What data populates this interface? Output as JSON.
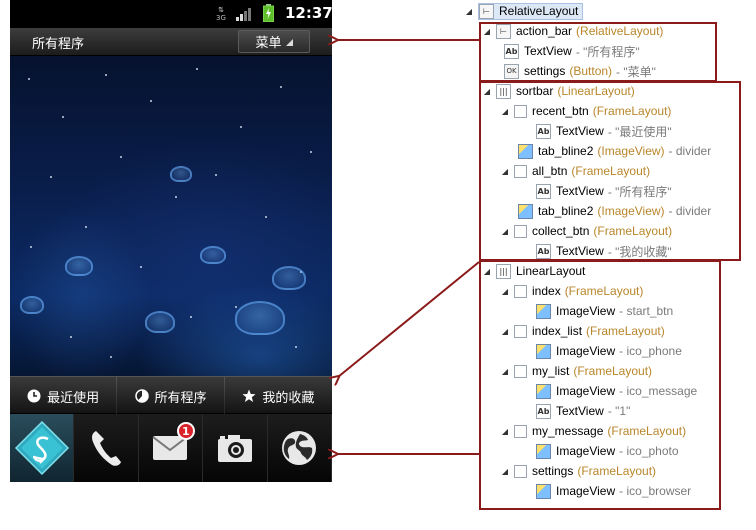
{
  "phone": {
    "statusbar": {
      "network_label": "3G",
      "time": "12:37"
    },
    "action_bar": {
      "title": "所有程序",
      "menu_label": "菜单"
    },
    "sortbar": {
      "recent_label": "最近使用",
      "all_label": "所有程序",
      "collect_label": "我的收藏"
    },
    "dock": {
      "items": [
        {
          "name": "start_btn",
          "icon": "app-launcher-icon"
        },
        {
          "name": "ico_phone",
          "icon": "phone-icon"
        },
        {
          "name": "ico_message",
          "icon": "mail-icon",
          "badge": "1"
        },
        {
          "name": "ico_photo",
          "icon": "camera-icon"
        },
        {
          "name": "ico_browser",
          "icon": "globe-icon"
        }
      ]
    },
    "colors": {
      "badge": "#d8242a",
      "accent": "#3bb4c8"
    }
  },
  "tree": {
    "root": "RelativeLayout",
    "nodes": [
      {
        "name": "action_bar",
        "type": "(RelativeLayout)",
        "desc": ""
      },
      {
        "name": "TextView",
        "type": "",
        "desc": "- \"所有程序\""
      },
      {
        "name": "settings",
        "type": "(Button)",
        "desc": "- \"菜单\""
      },
      {
        "name": "sortbar",
        "type": "(LinearLayout)",
        "desc": ""
      },
      {
        "name": "recent_btn",
        "type": "(FrameLayout)",
        "desc": ""
      },
      {
        "name": "TextView",
        "type": "",
        "desc": "- \"最近使用\""
      },
      {
        "name": "tab_bline2",
        "type": "(ImageView)",
        "desc": "- divider"
      },
      {
        "name": "all_btn",
        "type": "(FrameLayout)",
        "desc": ""
      },
      {
        "name": "TextView",
        "type": "",
        "desc": "- \"所有程序\""
      },
      {
        "name": "tab_bline2",
        "type": "(ImageView)",
        "desc": "- divider"
      },
      {
        "name": "collect_btn",
        "type": "(FrameLayout)",
        "desc": ""
      },
      {
        "name": "TextView",
        "type": "",
        "desc": "- \"我的收藏\""
      },
      {
        "name": "LinearLayout",
        "type": "",
        "desc": ""
      },
      {
        "name": "index",
        "type": "(FrameLayout)",
        "desc": ""
      },
      {
        "name": "ImageView",
        "type": "",
        "desc": "- start_btn"
      },
      {
        "name": "index_list",
        "type": "(FrameLayout)",
        "desc": ""
      },
      {
        "name": "ImageView",
        "type": "",
        "desc": "- ico_phone"
      },
      {
        "name": "my_list",
        "type": "(FrameLayout)",
        "desc": ""
      },
      {
        "name": "ImageView",
        "type": "",
        "desc": "- ico_message"
      },
      {
        "name": "TextView",
        "type": "",
        "desc": "- \"1\""
      },
      {
        "name": "my_message",
        "type": "(FrameLayout)",
        "desc": ""
      },
      {
        "name": "ImageView",
        "type": "",
        "desc": "- ico_photo"
      },
      {
        "name": "settings",
        "type": "(FrameLayout)",
        "desc": ""
      },
      {
        "name": "ImageView",
        "type": "",
        "desc": "- ico_browser"
      }
    ]
  }
}
